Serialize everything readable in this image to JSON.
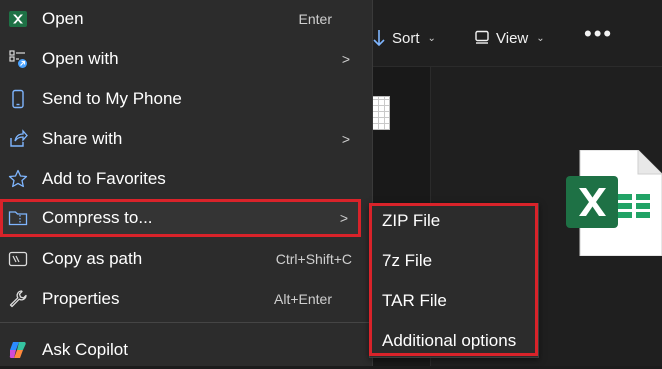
{
  "toolbar": {
    "sort_label": "Sort",
    "view_label": "View",
    "more_label": "•••"
  },
  "context_menu": {
    "items": [
      {
        "label": "Open",
        "shortcut": "Enter",
        "icon": "excel-icon"
      },
      {
        "label": "Open with",
        "icon": "open-with-icon",
        "has_submenu": true
      },
      {
        "label": "Send to My Phone",
        "icon": "phone-icon"
      },
      {
        "label": "Share with",
        "icon": "share-icon",
        "has_submenu": true
      },
      {
        "label": "Add to Favorites",
        "icon": "star-icon"
      },
      {
        "label": "Compress to...",
        "icon": "zip-folder-icon",
        "has_submenu": true,
        "highlighted": true
      },
      {
        "label": "Copy as path",
        "shortcut": "Ctrl+Shift+C",
        "icon": "copy-path-icon"
      },
      {
        "label": "Properties",
        "shortcut": "Alt+Enter",
        "icon": "wrench-icon"
      },
      {
        "label": "Ask Copilot",
        "icon": "copilot-icon"
      }
    ]
  },
  "submenu": {
    "items": [
      {
        "label": "ZIP File"
      },
      {
        "label": "7z File"
      },
      {
        "label": "TAR File"
      },
      {
        "label": "Additional options"
      }
    ]
  },
  "colors": {
    "menu_bg": "#2c2c2c",
    "highlight_border": "#d9232a",
    "excel_green": "#1e7145"
  }
}
